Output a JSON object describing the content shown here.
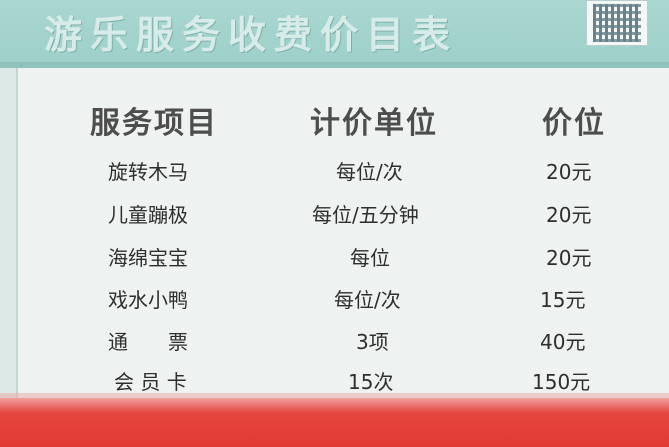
{
  "header": {
    "title": "游乐服务收费价目表"
  },
  "table": {
    "headers": [
      "服务项目",
      "计价单位",
      "价位"
    ],
    "rows": [
      {
        "item": "旋转木马",
        "unit": "每位/次",
        "price": "20元"
      },
      {
        "item": "儿童蹦极",
        "unit": "每位/五分钟",
        "price": "20元"
      },
      {
        "item": "海绵宝宝",
        "unit": "每位",
        "price": "20元"
      },
      {
        "item": "戏水小鸭",
        "unit": "每位/次",
        "price": "15元"
      },
      {
        "item": "通　　票",
        "unit": "3项",
        "price": "40元"
      },
      {
        "item": "会 员 卡",
        "unit": "15次",
        "price": "150元"
      }
    ]
  },
  "colors": {
    "header_band": "#a9d6d1",
    "panel": "#eef3f1",
    "bottom_band": "#e03a33"
  }
}
